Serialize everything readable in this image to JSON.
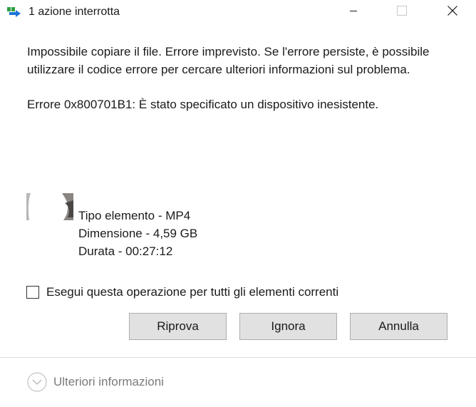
{
  "window": {
    "title": "1 azione interrotta"
  },
  "message": {
    "text": "Impossibile copiare il file. Errore imprevisto. Se l'errore persiste, è possibile utilizzare il codice errore per cercare ulteriori informazioni sul problema.",
    "error": "Errore 0x800701B1: È stato specificato un dispositivo inesistente."
  },
  "file": {
    "type": "Tipo elemento - MP4",
    "size": "Dimensione - 4,59 GB",
    "duration": "Durata - 00:27:12"
  },
  "checkbox": {
    "label": "Esegui questa operazione per tutti gli elementi correnti",
    "checked": false
  },
  "buttons": {
    "retry": "Riprova",
    "ignore": "Ignora",
    "cancel": "Annulla"
  },
  "footer": {
    "more_info": "Ulteriori informazioni"
  },
  "icons": {
    "app": "copy-transfer-icon",
    "minimize": "minimize-icon",
    "maximize": "maximize-icon",
    "close": "close-icon",
    "expand": "chevron-down-circle-icon"
  },
  "colors": {
    "title_icon_green": "#2e9e3e",
    "title_icon_blue": "#1e73d6",
    "button_bg": "#e1e1e1",
    "button_border": "#adadad",
    "muted_text": "#7a7a7a"
  }
}
